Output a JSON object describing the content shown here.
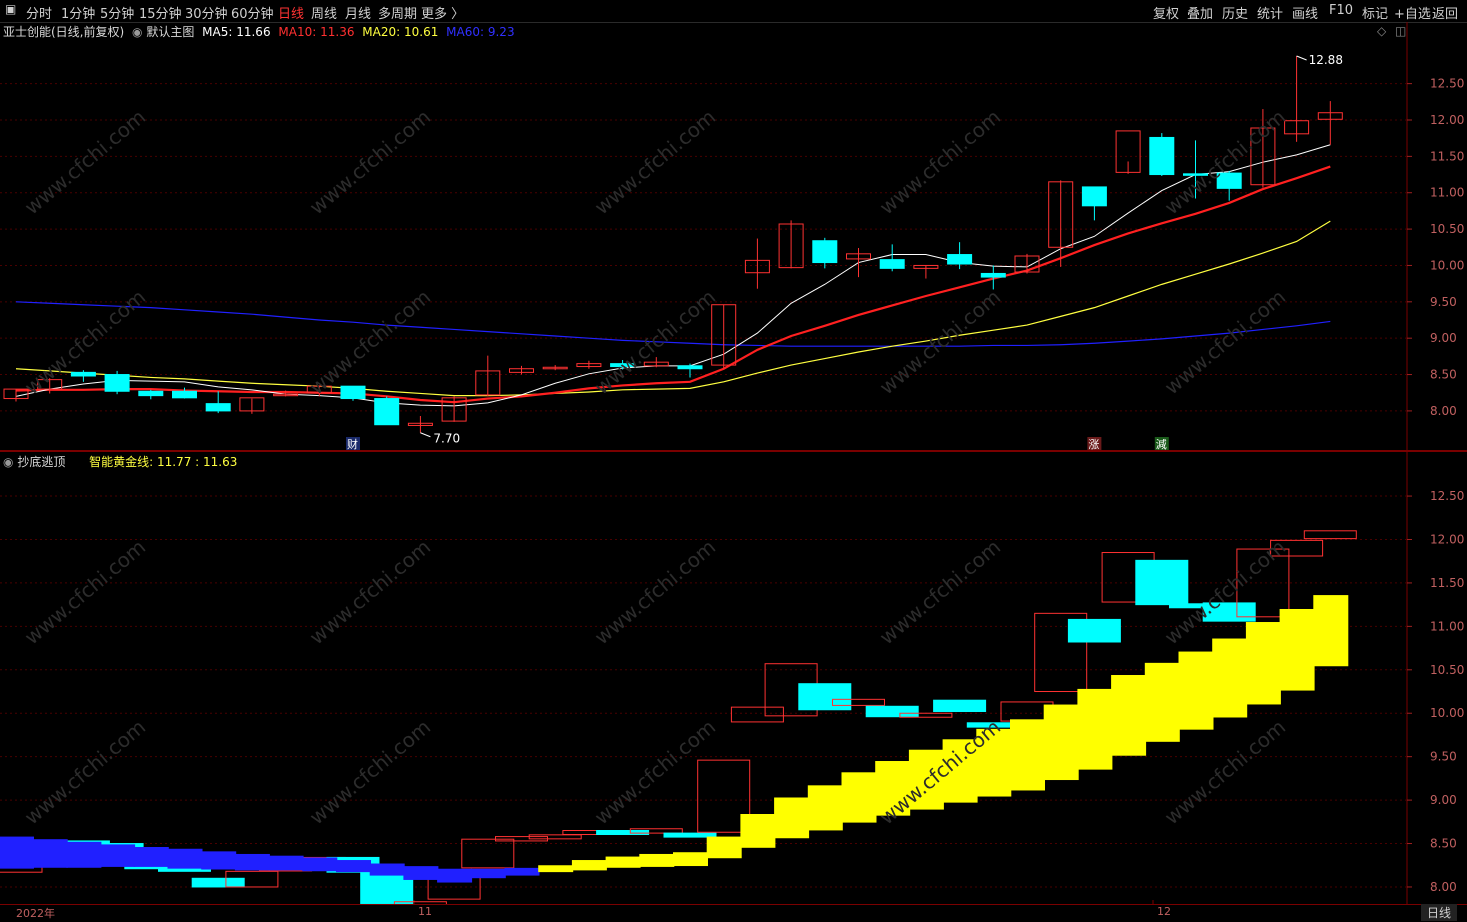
{
  "toolbar": {
    "left": [
      {
        "label": "分时",
        "active": false
      },
      {
        "label": "1分钟",
        "active": false
      },
      {
        "label": "5分钟",
        "active": false
      },
      {
        "label": "15分钟",
        "active": false
      },
      {
        "label": "30分钟",
        "active": false
      },
      {
        "label": "60分钟",
        "active": false
      },
      {
        "label": "日线",
        "active": true
      },
      {
        "label": "周线",
        "active": false
      },
      {
        "label": "月线",
        "active": false
      },
      {
        "label": "多周期",
        "active": false
      },
      {
        "label": "更多 〉",
        "active": false
      }
    ],
    "right": [
      "复权",
      "叠加",
      "历史",
      "统计",
      "画线",
      "F10",
      "标记",
      "+自选",
      "返回"
    ]
  },
  "main": {
    "stock": "亚士创能(日线,前复权)",
    "indicator": "默认主图",
    "ma5_label": "MA5: 11.66",
    "ma10_label": "MA10: 11.36",
    "ma20_label": "MA20: 10.61",
    "ma60_label": "MA60: 9.23",
    "high_label": "12.88",
    "low_label": "7.70",
    "event_cai": "财",
    "event_zhang": "涨",
    "event_jian": "減",
    "yticks": [
      "12.50",
      "12.00",
      "11.50",
      "11.00",
      "10.50",
      "10.00",
      "9.50",
      "9.00",
      "8.50",
      "8.00"
    ]
  },
  "sub": {
    "indicator": "抄底逃顶",
    "line_label": "智能黄金线: 11.77 : 11.63",
    "yticks": [
      "12.50",
      "12.00",
      "11.50",
      "11.00",
      "10.50",
      "10.00",
      "9.50",
      "9.00",
      "8.50",
      "8.00"
    ]
  },
  "xaxis": {
    "left": "2022年",
    "nov": "11",
    "dec": "12",
    "period_button": "日线"
  },
  "watermark": "www.cfchi.com",
  "colors": {
    "up": "#ff3232",
    "down": "#00ffff",
    "ma5": "#ffffff",
    "ma10": "#ff2020",
    "ma20": "#ffff40",
    "ma60": "#2020ff",
    "gold": "#ffff00"
  },
  "chart_data": {
    "type": "candlestick",
    "candles": [
      {
        "o": 8.17,
        "h": 8.3,
        "l": 8.13,
        "c": 8.3
      },
      {
        "o": 8.3,
        "h": 8.45,
        "l": 8.24,
        "c": 8.43
      },
      {
        "o": 8.53,
        "h": 8.56,
        "l": 8.4,
        "c": 8.48
      },
      {
        "o": 8.5,
        "h": 8.55,
        "l": 8.23,
        "c": 8.27
      },
      {
        "o": 8.27,
        "h": 8.29,
        "l": 8.16,
        "c": 8.21
      },
      {
        "o": 8.27,
        "h": 8.32,
        "l": 8.17,
        "c": 8.18
      },
      {
        "o": 8.1,
        "h": 8.27,
        "l": 7.97,
        "c": 8.0
      },
      {
        "o": 8.0,
        "h": 8.17,
        "l": 7.96,
        "c": 8.18
      },
      {
        "o": 8.22,
        "h": 8.28,
        "l": 8.2,
        "c": 8.23
      },
      {
        "o": 8.25,
        "h": 8.35,
        "l": 8.2,
        "c": 8.34
      },
      {
        "o": 8.34,
        "h": 8.34,
        "l": 8.14,
        "c": 8.17
      },
      {
        "o": 8.17,
        "h": 8.2,
        "l": 7.85,
        "c": 7.81
      },
      {
        "o": 7.8,
        "h": 7.93,
        "l": 7.7,
        "c": 7.83
      },
      {
        "o": 7.86,
        "h": 8.2,
        "l": 7.85,
        "c": 8.18
      },
      {
        "o": 8.22,
        "h": 8.76,
        "l": 8.2,
        "c": 8.55
      },
      {
        "o": 8.53,
        "h": 8.62,
        "l": 8.5,
        "c": 8.58
      },
      {
        "o": 8.58,
        "h": 8.63,
        "l": 8.56,
        "c": 8.6
      },
      {
        "o": 8.61,
        "h": 8.69,
        "l": 8.58,
        "c": 8.65
      },
      {
        "o": 8.65,
        "h": 8.7,
        "l": 8.57,
        "c": 8.61
      },
      {
        "o": 8.62,
        "h": 8.74,
        "l": 8.6,
        "c": 8.67
      },
      {
        "o": 8.62,
        "h": 8.65,
        "l": 8.46,
        "c": 8.58
      },
      {
        "o": 8.63,
        "h": 9.46,
        "l": 8.58,
        "c": 9.46
      },
      {
        "o": 9.9,
        "h": 10.37,
        "l": 9.68,
        "c": 10.07
      },
      {
        "o": 9.97,
        "h": 10.62,
        "l": 9.96,
        "c": 10.57
      },
      {
        "o": 10.34,
        "h": 10.38,
        "l": 9.96,
        "c": 10.04
      },
      {
        "o": 10.09,
        "h": 10.24,
        "l": 9.84,
        "c": 10.16
      },
      {
        "o": 10.08,
        "h": 10.29,
        "l": 9.92,
        "c": 9.96
      },
      {
        "o": 9.96,
        "h": 10.0,
        "l": 9.82,
        "c": 10.0
      },
      {
        "o": 10.15,
        "h": 10.32,
        "l": 9.95,
        "c": 10.02
      },
      {
        "o": 9.89,
        "h": 10.0,
        "l": 9.67,
        "c": 9.84
      },
      {
        "o": 9.91,
        "h": 10.16,
        "l": 9.89,
        "c": 10.13
      },
      {
        "o": 10.25,
        "h": 11.17,
        "l": 9.98,
        "c": 11.15
      },
      {
        "o": 11.08,
        "h": 11.08,
        "l": 10.62,
        "c": 10.82
      },
      {
        "o": 11.28,
        "h": 11.43,
        "l": 11.26,
        "c": 11.85
      },
      {
        "o": 11.76,
        "h": 11.82,
        "l": 11.23,
        "c": 11.25
      },
      {
        "o": 11.26,
        "h": 11.72,
        "l": 10.92,
        "c": 11.24
      },
      {
        "o": 11.27,
        "h": 11.3,
        "l": 10.89,
        "c": 11.06
      },
      {
        "o": 11.11,
        "h": 12.15,
        "l": 11.07,
        "c": 11.89
      },
      {
        "o": 11.81,
        "h": 12.88,
        "l": 11.7,
        "c": 11.99
      },
      {
        "o": 12.01,
        "h": 12.26,
        "l": 11.66,
        "c": 12.1
      }
    ],
    "ma5": [
      8.2,
      8.3,
      8.37,
      8.42,
      8.41,
      8.4,
      8.33,
      8.29,
      8.23,
      8.21,
      8.18,
      8.11,
      8.08,
      8.07,
      8.11,
      8.22,
      8.38,
      8.51,
      8.59,
      8.62,
      8.62,
      8.78,
      9.07,
      9.48,
      9.74,
      10.04,
      10.15,
      10.15,
      10.04,
      9.99,
      9.98,
      10.23,
      10.4,
      10.72,
      11.03,
      11.25,
      11.29,
      11.42,
      11.52,
      11.66
    ],
    "ma10": [
      8.28,
      8.29,
      8.29,
      8.3,
      8.3,
      8.28,
      8.27,
      8.26,
      8.26,
      8.25,
      8.24,
      8.2,
      8.15,
      8.12,
      8.17,
      8.2,
      8.25,
      8.31,
      8.35,
      8.38,
      8.4,
      8.58,
      8.84,
      9.03,
      9.17,
      9.32,
      9.45,
      9.58,
      9.7,
      9.82,
      9.93,
      10.1,
      10.28,
      10.44,
      10.58,
      10.71,
      10.86,
      11.05,
      11.2,
      11.36
    ],
    "ma20": [
      8.58,
      8.55,
      8.52,
      8.49,
      8.46,
      8.44,
      8.41,
      8.38,
      8.36,
      8.34,
      8.31,
      8.27,
      8.24,
      8.21,
      8.21,
      8.22,
      8.24,
      8.26,
      8.29,
      8.3,
      8.31,
      8.4,
      8.52,
      8.63,
      8.72,
      8.81,
      8.89,
      8.96,
      9.04,
      9.11,
      9.18,
      9.3,
      9.42,
      9.58,
      9.74,
      9.88,
      10.02,
      10.17,
      10.33,
      10.61
    ],
    "ma60": [
      9.5,
      9.48,
      9.46,
      9.44,
      9.42,
      9.39,
      9.36,
      9.33,
      9.29,
      9.25,
      9.22,
      9.18,
      9.15,
      9.12,
      9.09,
      9.06,
      9.03,
      9.0,
      8.97,
      8.95,
      8.93,
      8.91,
      8.9,
      8.89,
      8.89,
      8.89,
      8.89,
      8.89,
      8.89,
      8.9,
      8.9,
      8.91,
      8.93,
      8.96,
      8.99,
      9.03,
      9.07,
      9.12,
      9.17,
      9.23
    ],
    "ylim_main": [
      7.6,
      13.1
    ],
    "ylim_sub": [
      7.85,
      12.8
    ]
  }
}
